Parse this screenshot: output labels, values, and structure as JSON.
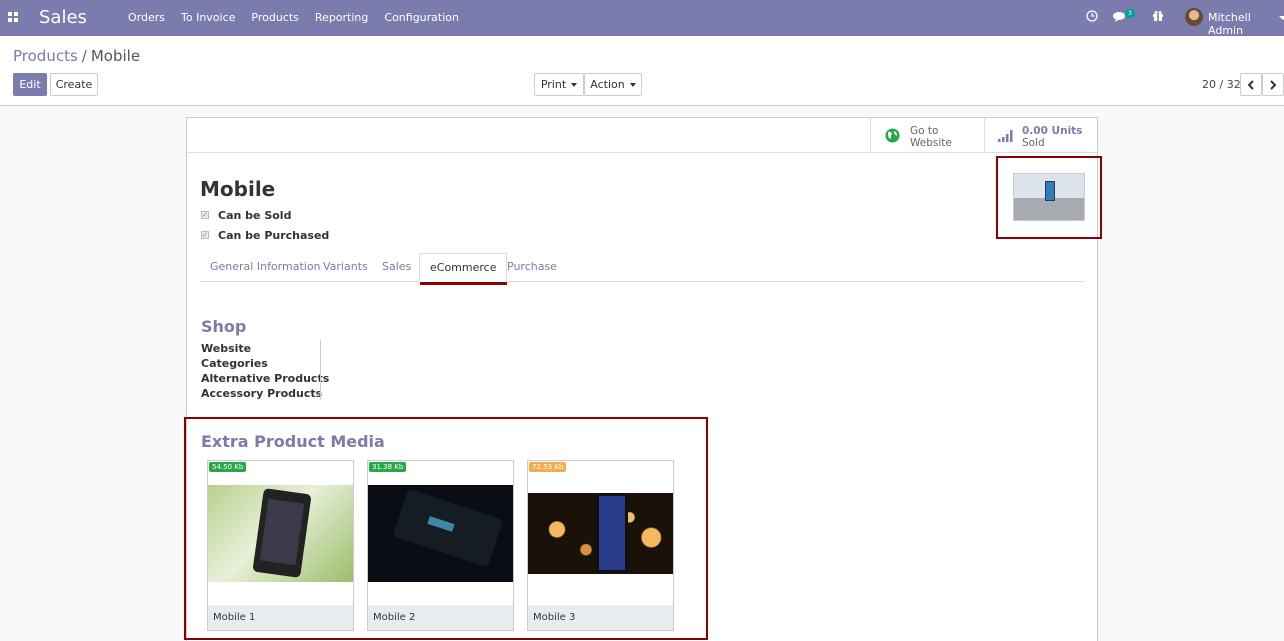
{
  "navbar": {
    "app_name": "Sales",
    "menu": [
      "Orders",
      "To Invoice",
      "Products",
      "Reporting",
      "Configuration"
    ],
    "messages_count": "3",
    "user_name": "Mitchell Admin",
    "icons": {
      "apps": "apps-grid-icon",
      "clock": "clock-icon",
      "chat": "chat-icon",
      "gift": "gift-icon"
    }
  },
  "control_panel": {
    "breadcrumb": {
      "parent": "Products",
      "separator": "/",
      "current": "Mobile"
    },
    "edit_label": "Edit",
    "create_label": "Create",
    "print_label": "Print",
    "action_label": "Action",
    "pager": "20 / 32"
  },
  "stat_buttons": {
    "website": {
      "line1": "Go to",
      "line2": "Website"
    },
    "sold": {
      "value": "0.00 Units",
      "label": "Sold"
    }
  },
  "product": {
    "name": "Mobile",
    "can_be_sold_label": "Can be Sold",
    "can_be_sold": true,
    "can_be_purchased_label": "Can be Purchased",
    "can_be_purchased": true
  },
  "tabs": [
    "General Information",
    "Variants",
    "Sales",
    "eCommerce",
    "Purchase"
  ],
  "active_tab": "eCommerce",
  "shop": {
    "title": "Shop",
    "fields": [
      "Website",
      "Categories",
      "Alternative Products",
      "Accessory Products"
    ]
  },
  "media": {
    "title": "Extra Product Media",
    "items": [
      {
        "name": "Mobile 1",
        "size": "54.50 Kb",
        "size_color": "#28a745"
      },
      {
        "name": "Mobile 2",
        "size": "31.38 Kb",
        "size_color": "#28a745"
      },
      {
        "name": "Mobile 3",
        "size": "72.53 Kb",
        "size_color": "#f0ad4e"
      }
    ]
  },
  "colors": {
    "brand": "#7c7bad",
    "highlight": "#8b0000"
  }
}
